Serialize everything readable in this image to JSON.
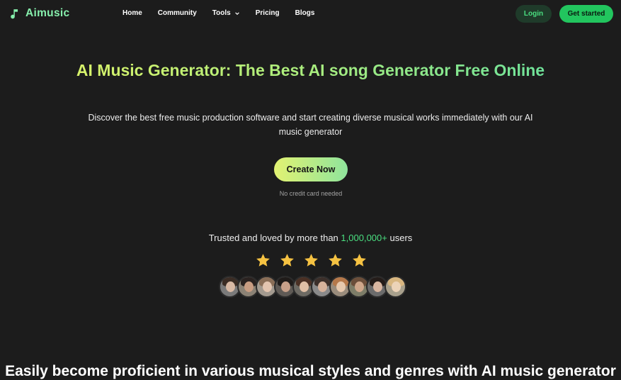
{
  "brand": {
    "name": "Aimusic",
    "icon": "music-note-icon",
    "color": "#86efac"
  },
  "nav": {
    "items": [
      {
        "label": "Home"
      },
      {
        "label": "Community"
      },
      {
        "label": "Tools",
        "icon": "chevron-down-icon"
      },
      {
        "label": "Pricing"
      },
      {
        "label": "Blogs"
      }
    ],
    "login_label": "Login",
    "get_started_label": "Get started"
  },
  "hero": {
    "title": "AI Music Generator: The Best AI song Generator Free Online",
    "subtitle": "Discover the best free music production software and start creating diverse musical works immediately with our AI music generator",
    "cta_label": "Create Now",
    "cta_note": "No credit card needed"
  },
  "trust": {
    "prefix": "Trusted and loved by more than",
    "count": "1,000,000+",
    "suffix": "users",
    "rating_stars": 5,
    "avatars": [
      {
        "icon": "user-avatar",
        "skin": "#d8b9a4",
        "hair": "#3a2c24",
        "bg": "#7a7a7a"
      },
      {
        "icon": "user-avatar",
        "skin": "#c99d82",
        "hair": "#2a2220",
        "bg": "#8b8275"
      },
      {
        "icon": "user-avatar",
        "skin": "#e3c5b0",
        "hair": "#8a6e57",
        "bg": "#a39a8f"
      },
      {
        "icon": "user-avatar",
        "skin": "#c7a089",
        "hair": "#1f1b19",
        "bg": "#5f5a55"
      },
      {
        "icon": "user-avatar",
        "skin": "#e0bfa5",
        "hair": "#4a3024",
        "bg": "#6d6a63"
      },
      {
        "icon": "user-avatar",
        "skin": "#d6b29b",
        "hair": "#3b2f2a",
        "bg": "#8a8a8a"
      },
      {
        "icon": "user-avatar",
        "skin": "#e7c8ad",
        "hair": "#b5784a",
        "bg": "#9a8c7c"
      },
      {
        "icon": "user-avatar",
        "skin": "#cfa78b",
        "hair": "#6b4e3a",
        "bg": "#7d7d68"
      },
      {
        "icon": "user-avatar",
        "skin": "#d9b6a0",
        "hair": "#241c19",
        "bg": "#6b6b6b"
      },
      {
        "icon": "user-avatar",
        "skin": "#ecd3b8",
        "hair": "#d8b680",
        "bg": "#a8a08c"
      }
    ]
  },
  "section": {
    "heading": "Easily become proficient in various musical styles and genres with AI music generator"
  },
  "colors": {
    "background": "#1c1c1c",
    "accent": "#22c55e",
    "highlight": "#4ade80",
    "star": "#f5c242"
  }
}
